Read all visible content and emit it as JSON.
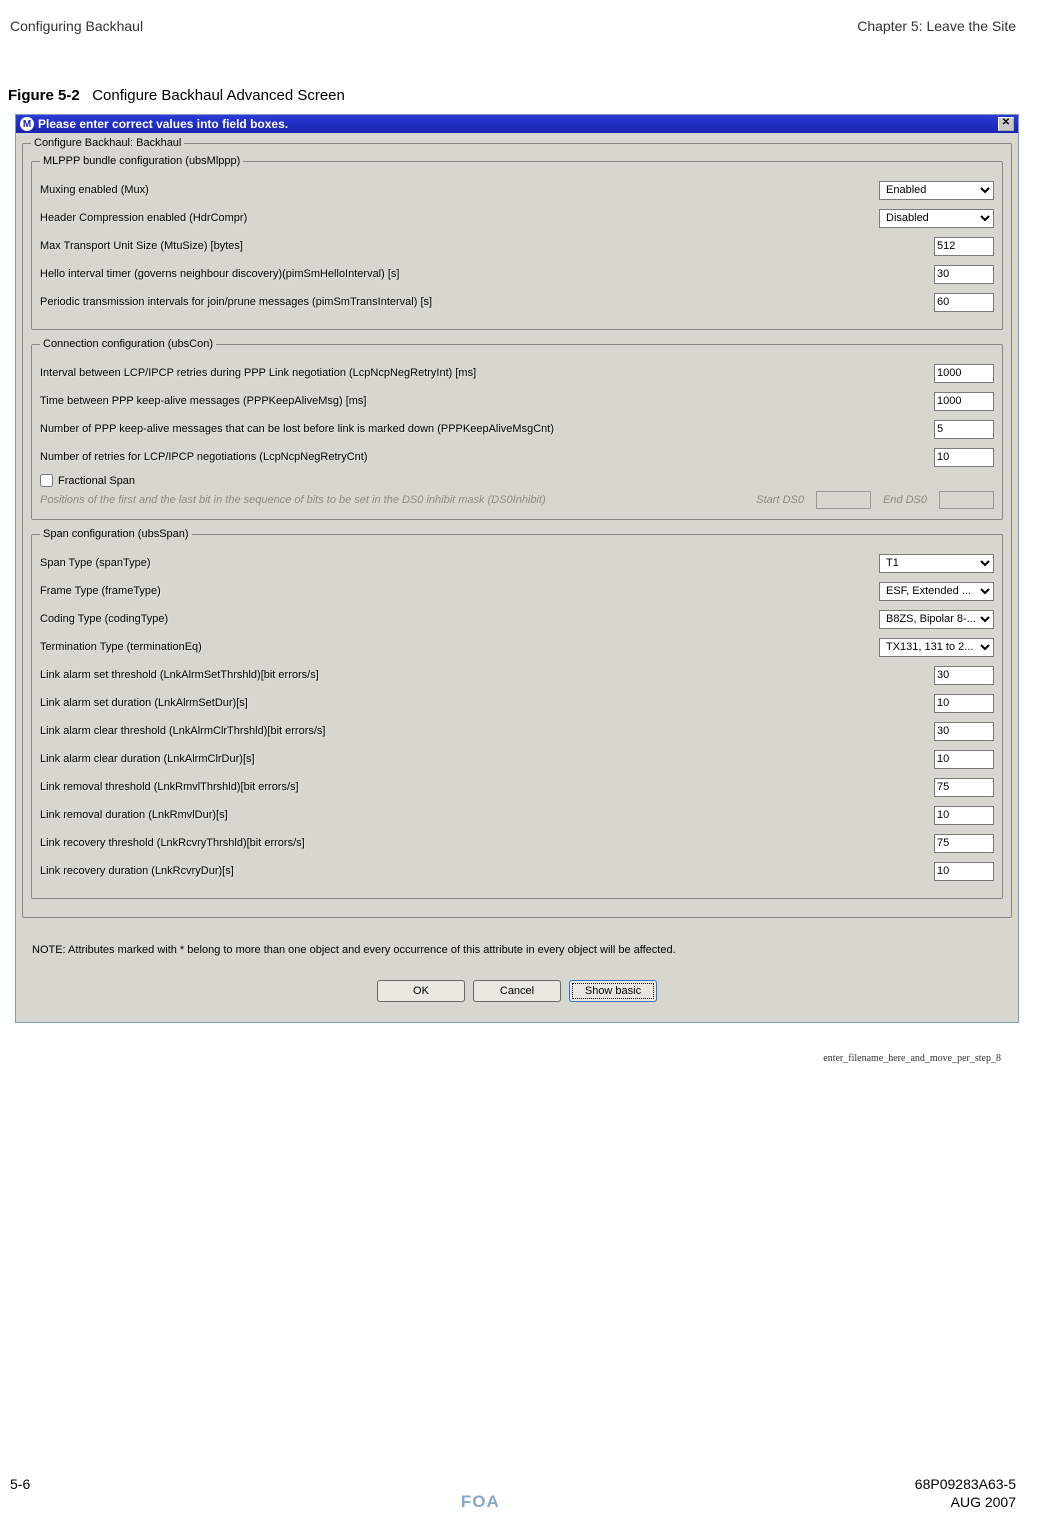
{
  "header": {
    "left": "Configuring Backhaul",
    "right": "Chapter 5: Leave the Site"
  },
  "figure": {
    "label": "Figure 5-2",
    "title": "Configure Backhaul Advanced Screen"
  },
  "dialog": {
    "title": "Please enter correct values into field boxes.",
    "outer_legend": "Configure Backhaul: Backhaul",
    "mlppp": {
      "legend": "MLPPP bundle configuration (ubsMlppp)",
      "rows": [
        {
          "label": "Muxing enabled (Mux)",
          "type": "select",
          "value": "Enabled"
        },
        {
          "label": "Header Compression enabled (HdrCompr)",
          "type": "select",
          "value": "Disabled"
        },
        {
          "label": "Max Transport Unit Size (MtuSize) [bytes]",
          "type": "text",
          "value": "512"
        },
        {
          "label": "Hello interval timer (governs neighbour discovery)(pimSmHelloInterval) [s]",
          "type": "text",
          "value": "30"
        },
        {
          "label": "Periodic transmission intervals for join/prune messages (pimSmTransInterval) [s]",
          "type": "text",
          "value": "60"
        }
      ]
    },
    "conn": {
      "legend": "Connection configuration (ubsCon)",
      "rows": [
        {
          "label": "Interval between LCP/IPCP retries during PPP Link negotiation (LcpNcpNegRetryInt) [ms]",
          "type": "text",
          "value": "1000"
        },
        {
          "label": "Time between PPP keep-alive messages (PPPKeepAliveMsg) [ms]",
          "type": "text",
          "value": "1000"
        },
        {
          "label": "Number of PPP keep-alive messages that can be lost before link is marked down (PPPKeepAliveMsgCnt)",
          "type": "text",
          "value": "5"
        },
        {
          "label": "Number of retries for LCP/IPCP negotiations (LcpNcpNegRetryCnt)",
          "type": "text",
          "value": "10"
        }
      ],
      "fractional_label": "Fractional Span",
      "disabled_label": "Positions of the first and the last bit in the sequence of bits to be set in the DS0 inhibit mask (DS0Inhibit)",
      "start_label": "Start DS0",
      "end_label": "End DS0"
    },
    "span": {
      "legend": "Span configuration (ubsSpan)",
      "rows": [
        {
          "label": "Span Type (spanType)",
          "type": "select",
          "value": "T1"
        },
        {
          "label": "Frame Type (frameType)",
          "type": "select",
          "value": "ESF, Extended ..."
        },
        {
          "label": "Coding Type (codingType)",
          "type": "select",
          "value": "B8ZS, Bipolar 8-..."
        },
        {
          "label": "Termination Type (terminationEq)",
          "type": "select",
          "value": "TX131, 131 to 2..."
        },
        {
          "label": "Link alarm set threshold (LnkAlrmSetThrshld)[bit errors/s]",
          "type": "text",
          "value": "30"
        },
        {
          "label": "Link alarm set duration (LnkAlrmSetDur)[s]",
          "type": "text",
          "value": "10"
        },
        {
          "label": "Link alarm clear threshold (LnkAlrmClrThrshld)[bit errors/s]",
          "type": "text",
          "value": "30"
        },
        {
          "label": "Link alarm clear duration (LnkAlrmClrDur)[s]",
          "type": "text",
          "value": "10"
        },
        {
          "label": "Link removal threshold (LnkRmvlThrshld)[bit errors/s]",
          "type": "text",
          "value": "75"
        },
        {
          "label": "Link removal duration (LnkRmvlDur)[s]",
          "type": "text",
          "value": "10"
        },
        {
          "label": "Link recovery threshold (LnkRcvryThrshld)[bit errors/s]",
          "type": "text",
          "value": "75"
        },
        {
          "label": "Link recovery duration (LnkRcvryDur)[s]",
          "type": "text",
          "value": "10"
        }
      ]
    },
    "note": "NOTE: Attributes marked with * belong to more than one object and every occurrence of this attribute in every object will be affected.",
    "buttons": {
      "ok": "OK",
      "cancel": "Cancel",
      "show_basic": "Show basic"
    }
  },
  "image_ref": "enter_filename_here_and_move_per_step_8",
  "footer": {
    "page": "5-6",
    "doc": "68P09283A63-5",
    "foa": "FOA",
    "date": "AUG 2007"
  }
}
